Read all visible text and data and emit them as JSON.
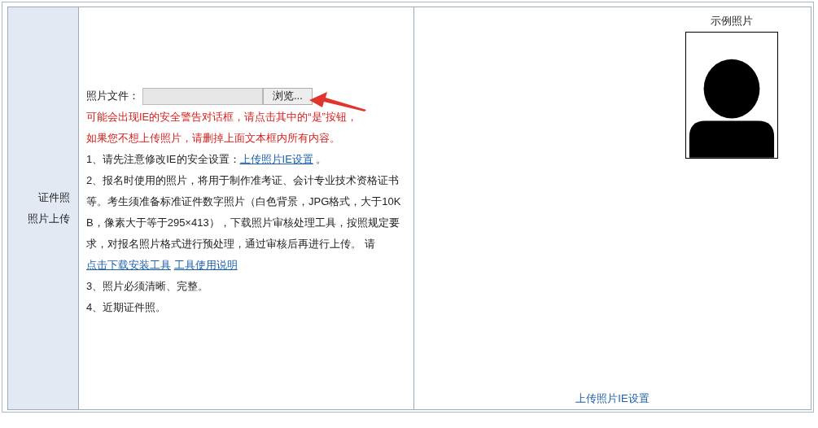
{
  "label_lines": [
    "证件照",
    "照片上传"
  ],
  "file_field": {
    "label": "照片文件：",
    "browse_button": "浏览..."
  },
  "warnings": [
    "可能会出现IE的安全警告对话框，请点击其中的“是”按钮，",
    "如果您不想上传照片，请删掉上面文本框内所有内容。"
  ],
  "instructions": [
    {
      "text": "1、请先注意修改IE的安全设置：",
      "links": [
        "上传照片IE设置"
      ],
      "suffix": " 。"
    },
    {
      "text": "2、报名时使用的照片，将用于制作准考证、会计专业技术资格证书等。考生须准备标准证件数字照片（白色背景，JPG格式，大于10KB，像素大于等于295×413），下载照片审核处理工具，按照规定要求，对报名照片格式进行预处理，通过审核后再进行上传。 请",
      "links": [
        "点击下载安装工具",
        "工具使用说明"
      ]
    },
    {
      "text": "3、照片必须清晰、完整。"
    },
    {
      "text": "4、近期证件照。"
    }
  ],
  "sample": {
    "title": "示例照片"
  },
  "bottom_link": "上传照片IE设置"
}
